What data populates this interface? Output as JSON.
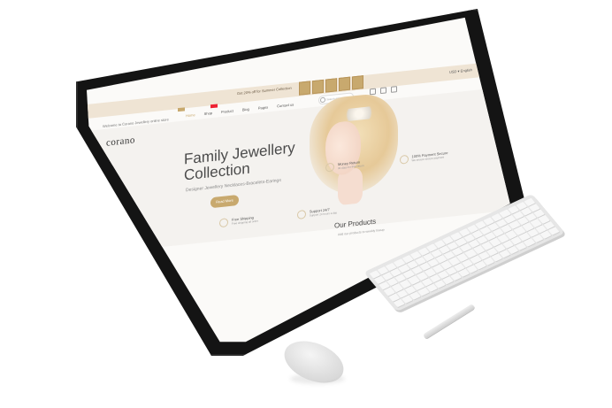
{
  "site": {
    "logo": "corano",
    "promo_text": "Get 20% off for Summer Collection",
    "welcome_text": "Welcome to Corano Jewellery online store",
    "lang": "USD ▾ English",
    "search_placeholder": "Search entire store",
    "nav": [
      "Home",
      "Shop",
      "Product",
      "Blog",
      "Pages",
      "Contact us"
    ]
  },
  "hero": {
    "title_line1": "Family Jewellery",
    "title_line2": "Collection",
    "subtitle": "Designer Jewellery Necklaces-Bracelets-Earings",
    "button": "Read More"
  },
  "features_a": [
    {
      "title": "Money Return",
      "desc": "30 days for free return"
    },
    {
      "title": "100% Payment Secure",
      "desc": "We ensure secure payment"
    }
  ],
  "features_b": [
    {
      "title": "Free Shipping",
      "desc": "Free shipping all order"
    },
    {
      "title": "Support 24/7",
      "desc": "Support 24 hours a day"
    }
  ],
  "section": {
    "title": "Our Products",
    "subtitle": "Add our products to weekly lineup"
  },
  "colors": {
    "accent": "#c8a96e",
    "topbar": "#efe4d4",
    "screen_bg": "#fbfaf8"
  }
}
